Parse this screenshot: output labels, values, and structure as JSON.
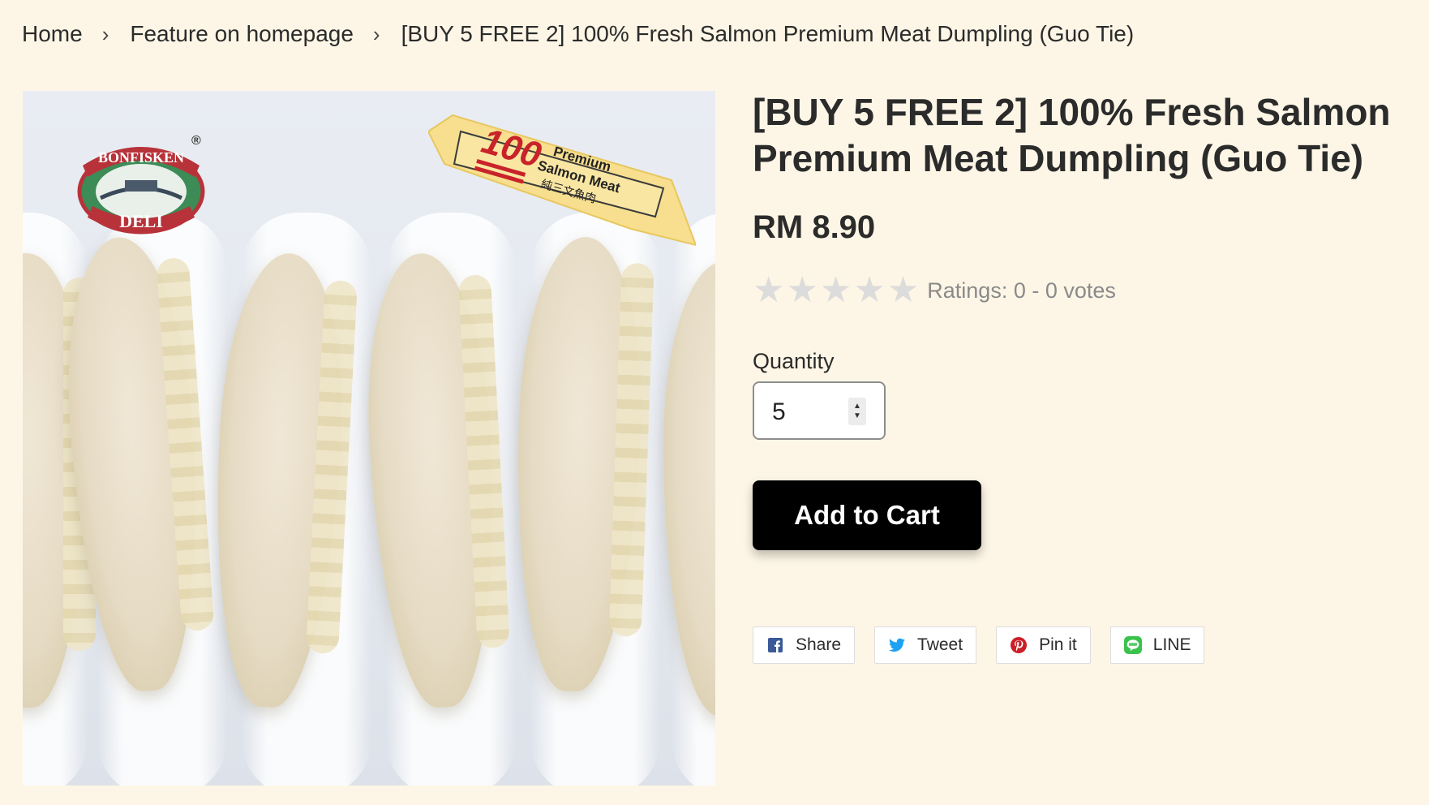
{
  "breadcrumb": {
    "home": "Home",
    "separator": "›",
    "category": "Feature on homepage",
    "current": "[BUY 5 FREE 2] 100% Fresh Salmon Premium Meat Dumpling (Guo Tie)"
  },
  "image": {
    "logo_text_top": "BONFISKEN",
    "logo_text_bottom": "DELI",
    "logo_mark": "®",
    "banner_number": "100",
    "banner_line1": "Premium",
    "banner_line2": "Salmon Meat",
    "banner_line3": "純三文魚肉"
  },
  "product": {
    "title": "[BUY 5 FREE 2] 100% Fresh Salmon Premium Meat Dumpling (Guo Tie)",
    "price": "RM 8.90",
    "rating": {
      "value": 0,
      "max": 5,
      "star_glyph": "★",
      "text": "Ratings: 0 - 0 votes"
    },
    "quantity_label": "Quantity",
    "quantity_value": "5",
    "add_to_cart": "Add to Cart"
  },
  "share": {
    "facebook": "Share",
    "twitter": "Tweet",
    "pinterest": "Pin it",
    "line": "LINE"
  },
  "colors": {
    "background": "#fdf6e6",
    "button": "#000000",
    "facebook": "#3b5998",
    "twitter": "#1da1f2",
    "pinterest": "#cb2027",
    "line": "#3ac34c"
  }
}
